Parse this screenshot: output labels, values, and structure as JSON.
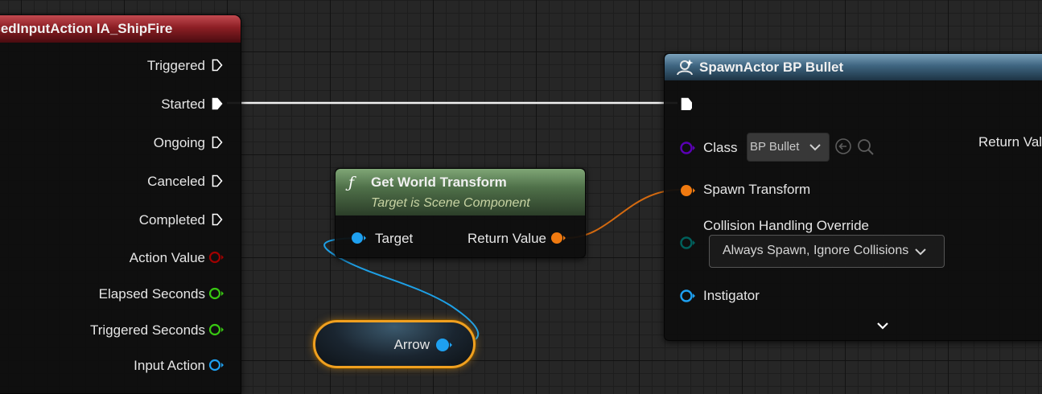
{
  "event_node": {
    "title": "ncedInputAction IA_ShipFire",
    "pins": [
      {
        "label": "Triggered",
        "type": "exec"
      },
      {
        "label": "Started",
        "type": "exec"
      },
      {
        "label": "Ongoing",
        "type": "exec"
      },
      {
        "label": "Canceled",
        "type": "exec"
      },
      {
        "label": "Completed",
        "type": "exec"
      },
      {
        "label": "Action Value",
        "type": "data"
      },
      {
        "label": "Elapsed Seconds",
        "type": "data"
      },
      {
        "label": "Triggered Seconds",
        "type": "data"
      },
      {
        "label": "Input Action",
        "type": "data"
      }
    ]
  },
  "get_world_transform": {
    "icon": "function-icon",
    "title": "Get World Transform",
    "subtitle": "Target is Scene Component",
    "input_label": "Target",
    "output_label": "Return Value"
  },
  "arrow_node": {
    "label": "Arrow"
  },
  "spawn_actor": {
    "icon": "spawn-actor-icon",
    "title": "SpawnActor BP Bullet",
    "class_label": "Class",
    "class_value": "BP Bullet",
    "return_value_label": "Return Val",
    "spawn_transform_label": "Spawn Transform",
    "collision_label": "Collision Handling Override",
    "collision_value": "Always Spawn, Ignore Collisions",
    "instigator_label": "Instigator"
  },
  "colors": {
    "exec": "#ffffff",
    "struct_pin": "#f07a10",
    "object_pin": "#1ea0f0",
    "float_pin": "#38c812",
    "enum_pin": "#00605c",
    "class_pin": "#5a00b4",
    "action_value_pin": "#a00000",
    "selection": "#f0a020"
  }
}
